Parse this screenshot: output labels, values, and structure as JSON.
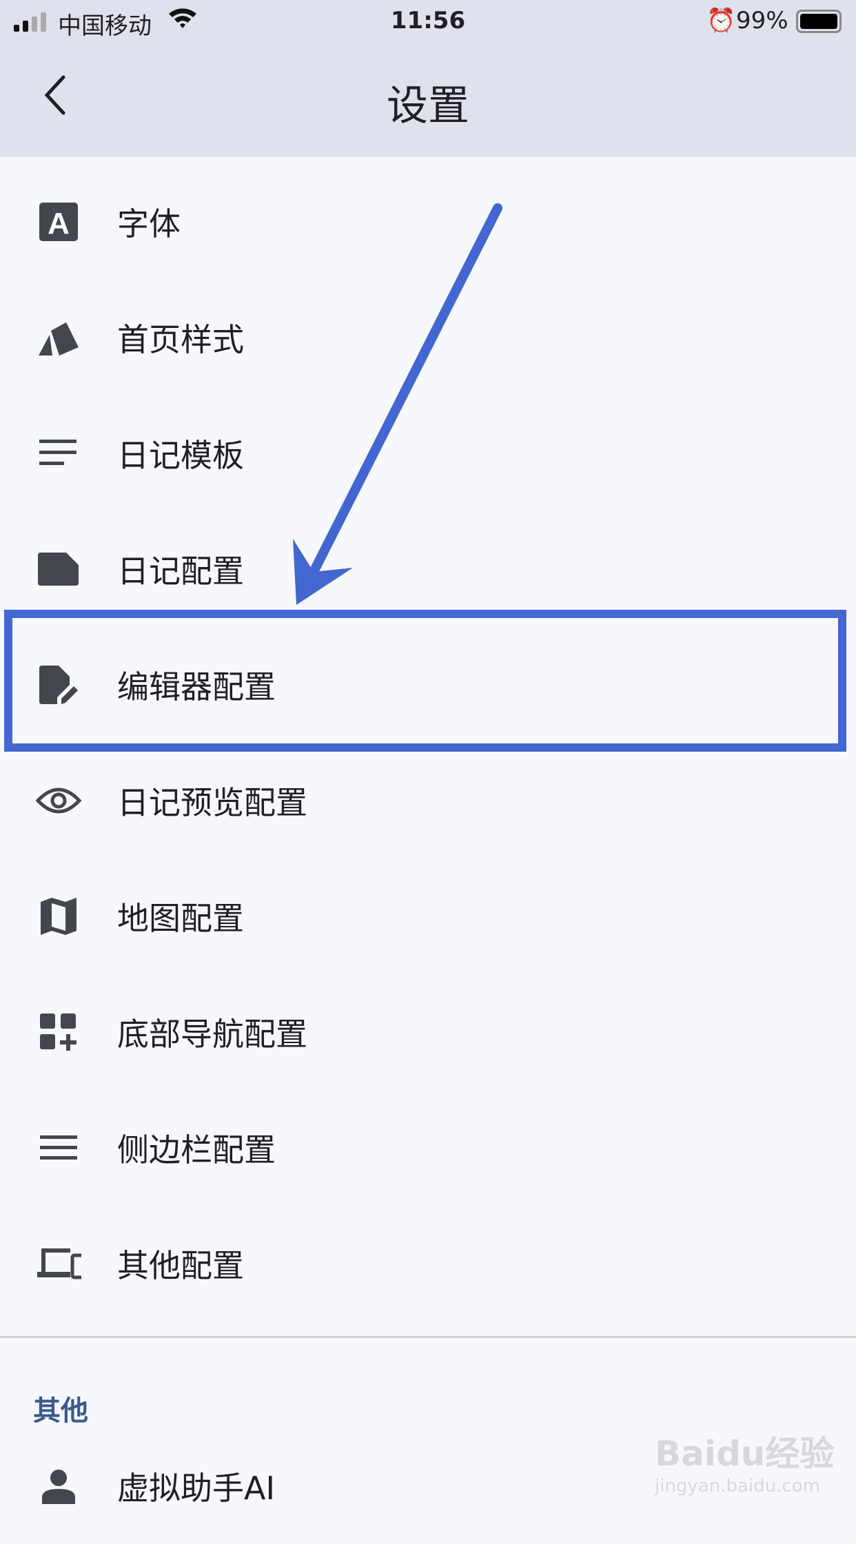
{
  "status_bar": {
    "carrier": "中国移动",
    "time": "11:56",
    "battery": "99%",
    "battery_level": 0.99
  },
  "header": {
    "title": "设置"
  },
  "items": [
    {
      "label": "字体",
      "icon": "font-icon"
    },
    {
      "label": "首页样式",
      "icon": "cards-icon"
    },
    {
      "label": "日记模板",
      "icon": "lines-icon"
    },
    {
      "label": "日记配置",
      "icon": "note-icon"
    },
    {
      "label": "编辑器配置",
      "icon": "edit-document-icon",
      "highlighted": true
    },
    {
      "label": "日记预览配置",
      "icon": "eye-icon"
    },
    {
      "label": "地图配置",
      "icon": "map-icon"
    },
    {
      "label": "底部导航配置",
      "icon": "grid-add-icon"
    },
    {
      "label": "侧边栏配置",
      "icon": "menu-icon"
    },
    {
      "label": "其他配置",
      "icon": "devices-icon"
    }
  ],
  "section_other": {
    "title": "其他",
    "items": [
      {
        "label": "虚拟助手AI",
        "icon": "person-icon"
      }
    ]
  },
  "watermark": {
    "text": "Baidu经验",
    "sub": "jingyan.baidu.com"
  },
  "colors": {
    "annotation": "#4466d0",
    "section": "#3a5a8a",
    "header_bg": "#dfe2ec",
    "page_bg": "#f7f8fd"
  }
}
